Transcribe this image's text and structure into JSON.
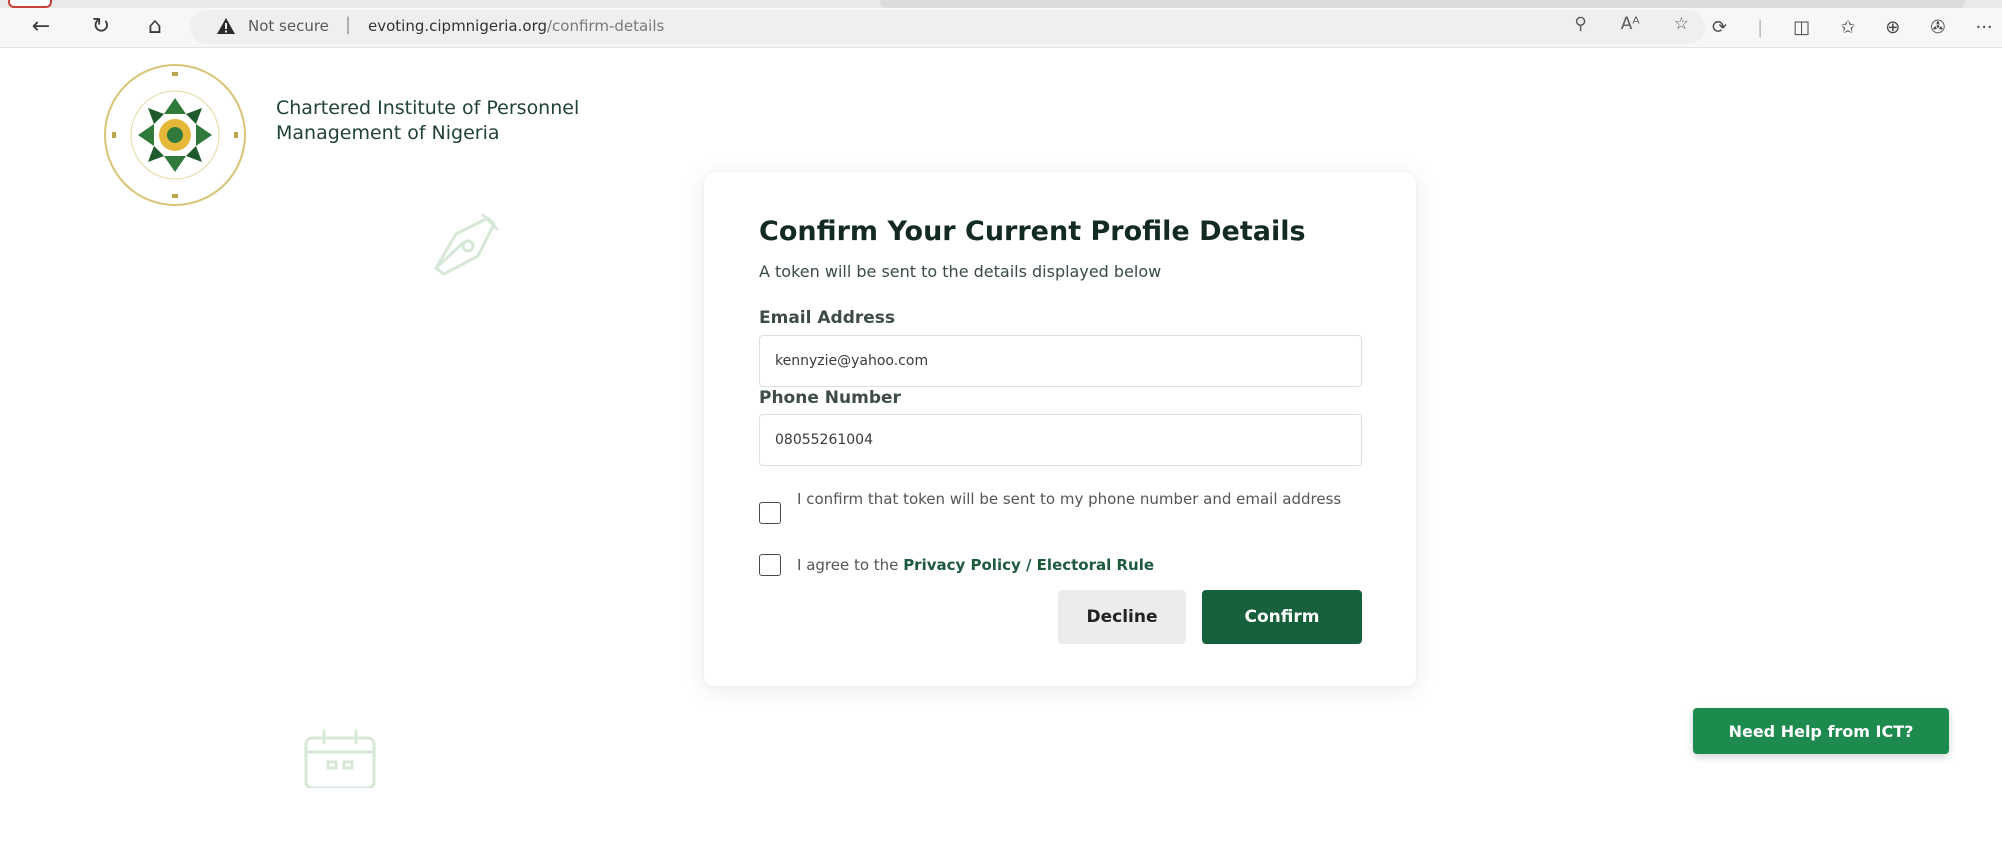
{
  "browser": {
    "back_icon": "←",
    "reload_icon": "↻",
    "home_icon": "⌂",
    "security_label": "Not secure",
    "separator": "|",
    "url_host": "evoting.cipmnigeria.org",
    "url_path": "/confirm-details",
    "addr_tools": [
      "⚲",
      "Aᴬ",
      "☆"
    ],
    "toolbar_icons": [
      "⟳",
      "|",
      "◫",
      "✩",
      "⊕",
      "✇",
      "···"
    ]
  },
  "org": {
    "name": "Chartered Institute of Personnel Management of Nigeria"
  },
  "card": {
    "title": "Confirm Your Current Profile Details",
    "subtitle": "A token will be sent to the details displayed below",
    "email_label": "Email Address",
    "email_value": "kennyzie@yahoo.com",
    "phone_label": "Phone Number",
    "phone_value": "08055261004",
    "confirm_check_text": "I confirm that token will be sent to my phone number and email address",
    "agree_prefix": "I agree to the ",
    "agree_link": "Privacy Policy / Electoral Rule",
    "decline_label": "Decline",
    "confirm_label": "Confirm"
  },
  "help": {
    "label": "Need Help from ICT?"
  },
  "colors": {
    "primary": "#17603c",
    "help": "#1d8a4e",
    "decline_bg": "#ececec"
  }
}
